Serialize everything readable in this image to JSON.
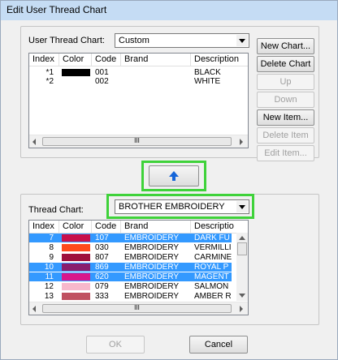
{
  "window": {
    "title": "Edit User Thread Chart"
  },
  "user_chart": {
    "label": "User Thread Chart:",
    "selected": "Custom",
    "columns": [
      "Index",
      "Color",
      "Code",
      "Brand",
      "Description"
    ],
    "rows": [
      {
        "index": "*1",
        "color": "#000000",
        "code": "001",
        "brand": "",
        "description": "BLACK"
      },
      {
        "index": "*2",
        "color": "#ffffff",
        "code": "002",
        "brand": "",
        "description": "WHITE"
      }
    ],
    "scroll_thumb_label": "III"
  },
  "buttons": {
    "new_chart": "New Chart...",
    "delete_chart": "Delete Chart",
    "up": "Up",
    "down": "Down",
    "new_item": "New Item...",
    "delete_item": "Delete Item",
    "edit_item": "Edit Item...",
    "ok": "OK",
    "cancel": "Cancel"
  },
  "thread_chart": {
    "label": "Thread Chart:",
    "selected": "BROTHER EMBROIDERY",
    "columns": [
      "Index",
      "Color",
      "Code",
      "Brand",
      "Descriptio"
    ],
    "rows": [
      {
        "index": "7",
        "color": "#c8104b",
        "code": "107",
        "brand": "EMBROIDERY",
        "description": "DARK FU",
        "selected": true
      },
      {
        "index": "8",
        "color": "#ff4a1c",
        "code": "030",
        "brand": "EMBROIDERY",
        "description": "VERMILLI",
        "selected": false
      },
      {
        "index": "9",
        "color": "#a0103c",
        "code": "807",
        "brand": "EMBROIDERY",
        "description": "CARMINE",
        "selected": false
      },
      {
        "index": "10",
        "color": "#8a1e6e",
        "code": "869",
        "brand": "EMBROIDERY",
        "description": "ROYAL P",
        "selected": true
      },
      {
        "index": "11",
        "color": "#d8168c",
        "code": "620",
        "brand": "EMBROIDERY",
        "description": "MAGENT",
        "selected": true
      },
      {
        "index": "12",
        "color": "#f8b8cc",
        "code": "079",
        "brand": "EMBROIDERY",
        "description": "SALMON",
        "selected": false
      },
      {
        "index": "13",
        "color": "#c05060",
        "code": "333",
        "brand": "EMBROIDERY",
        "description": "AMBER R",
        "selected": false
      }
    ],
    "scroll_thumb_label": "III"
  },
  "colors": {
    "highlight": "#3fd23a",
    "selection": "#3399ff",
    "arrow": "#1565d8"
  },
  "icons": {
    "transfer": "up-arrow-icon"
  }
}
